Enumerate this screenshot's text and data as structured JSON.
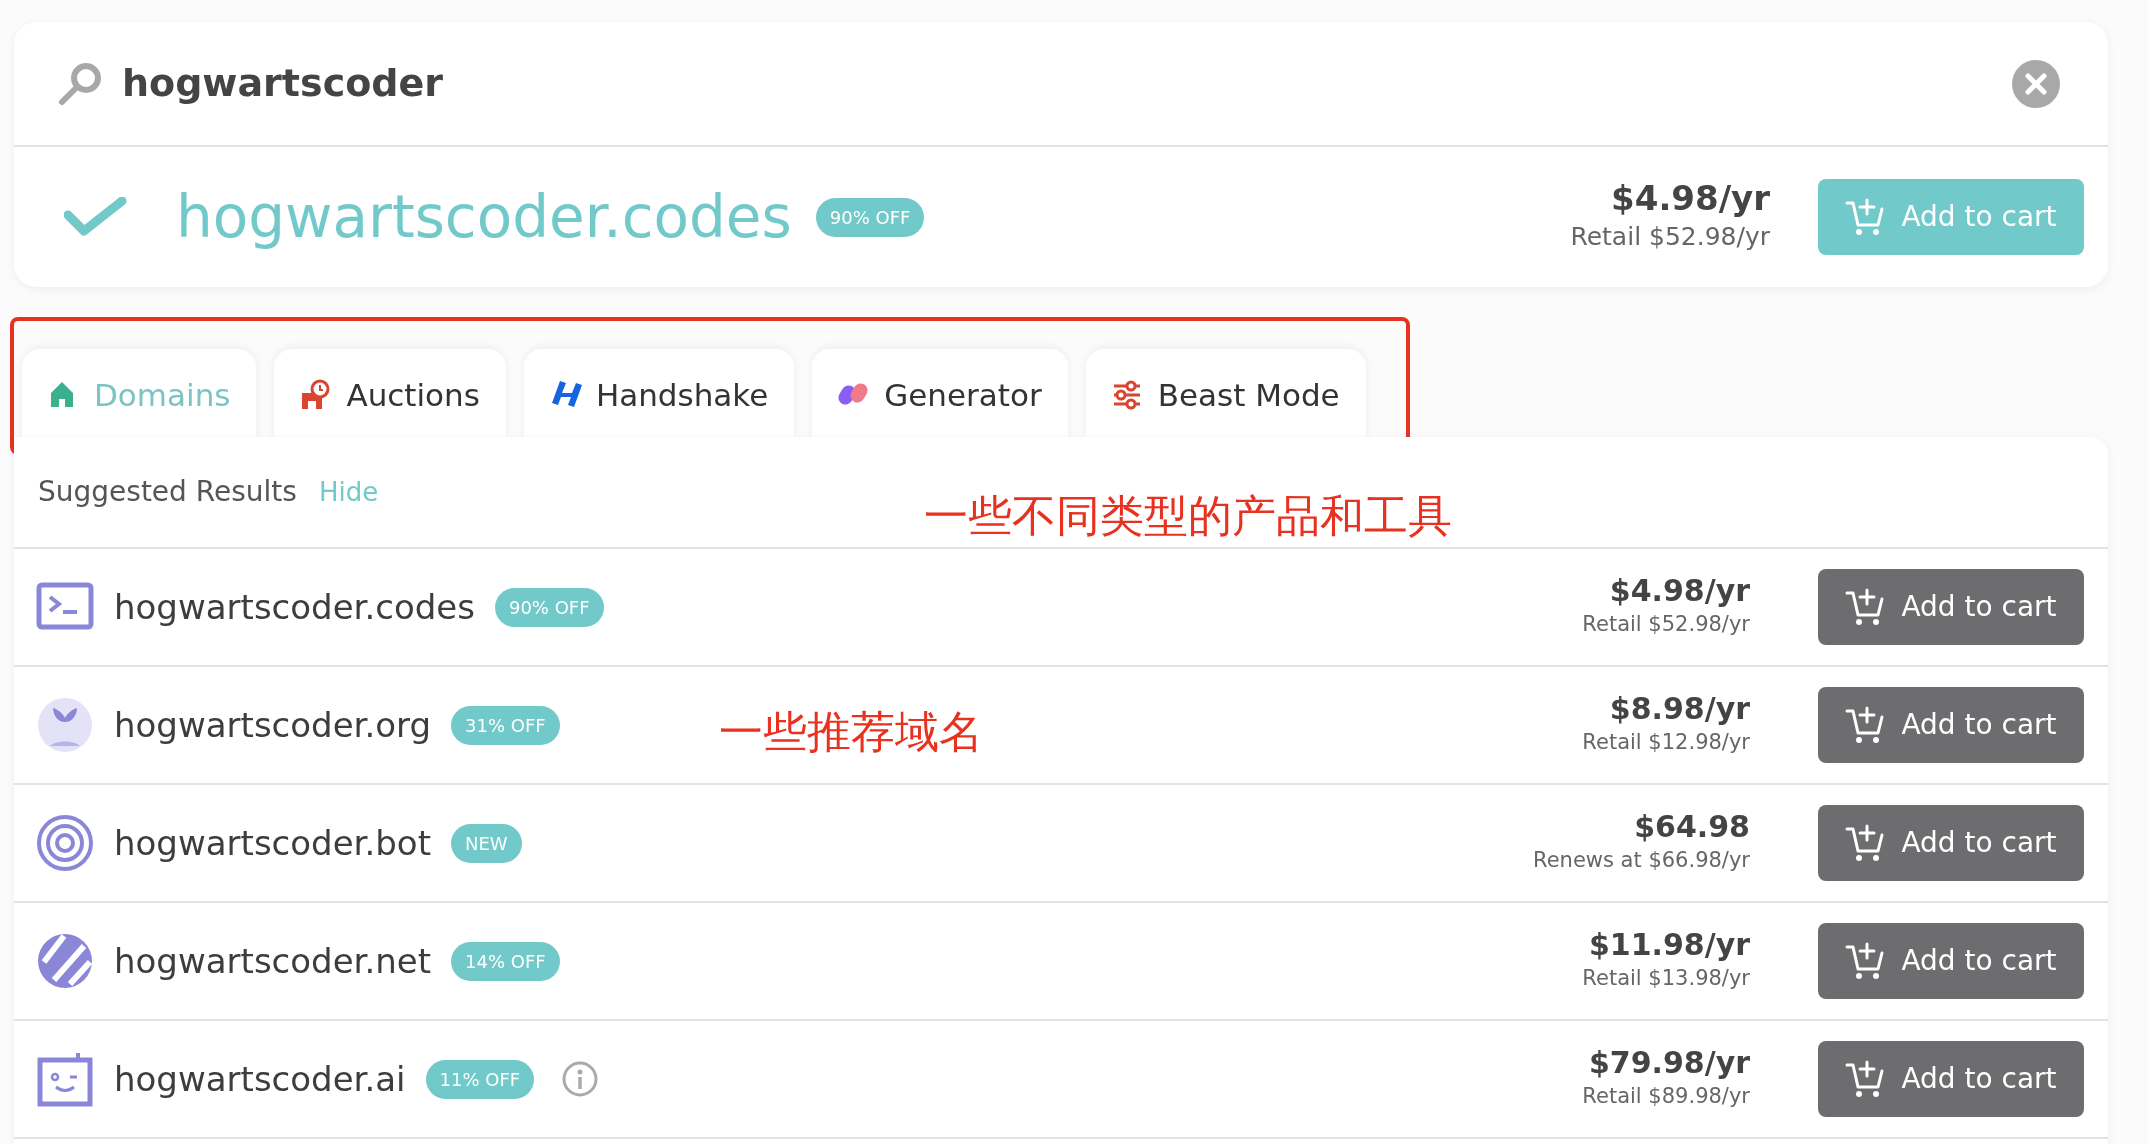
{
  "search": {
    "query": "hogwartscoder"
  },
  "top_result": {
    "available": true,
    "domain": "hogwartscoder.codes",
    "badge": "90% OFF",
    "price": "$4.98/yr",
    "note": "Retail $52.98/yr",
    "button": "Add to cart"
  },
  "tabs_highlighted": true,
  "tabs": [
    {
      "label": "Domains",
      "selected": true
    },
    {
      "label": "Auctions",
      "selected": false
    },
    {
      "label": "Handshake",
      "selected": false
    },
    {
      "label": "Generator",
      "selected": false
    },
    {
      "label": "Beast Mode",
      "selected": false
    }
  ],
  "suggested": {
    "title": "Suggested Results",
    "hide": "Hide",
    "annotation": "一些不同类型的产品和工具"
  },
  "rows": [
    {
      "domain": "hogwartscoder.codes",
      "badge": "90% OFF",
      "info": false,
      "price": "$4.98/yr",
      "note": "Retail $52.98/yr",
      "button": "Add to cart"
    },
    {
      "domain": "hogwartscoder.org",
      "badge": "31% OFF",
      "info": false,
      "price": "$8.98/yr",
      "note": "Retail $12.98/yr",
      "button": "Add to cart",
      "annotation": "一些推荐域名"
    },
    {
      "domain": "hogwartscoder.bot",
      "badge": "NEW",
      "info": false,
      "price": "$64.98",
      "note": "Renews at $66.98/yr",
      "button": "Add to cart"
    },
    {
      "domain": "hogwartscoder.net",
      "badge": "14% OFF",
      "info": false,
      "price": "$11.98/yr",
      "note": "Retail $13.98/yr",
      "button": "Add to cart"
    },
    {
      "domain": "hogwartscoder.ai",
      "badge": "11% OFF",
      "info": true,
      "price": "$79.98/yr",
      "note": "Retail $89.98/yr",
      "button": "Add to cart"
    }
  ]
}
